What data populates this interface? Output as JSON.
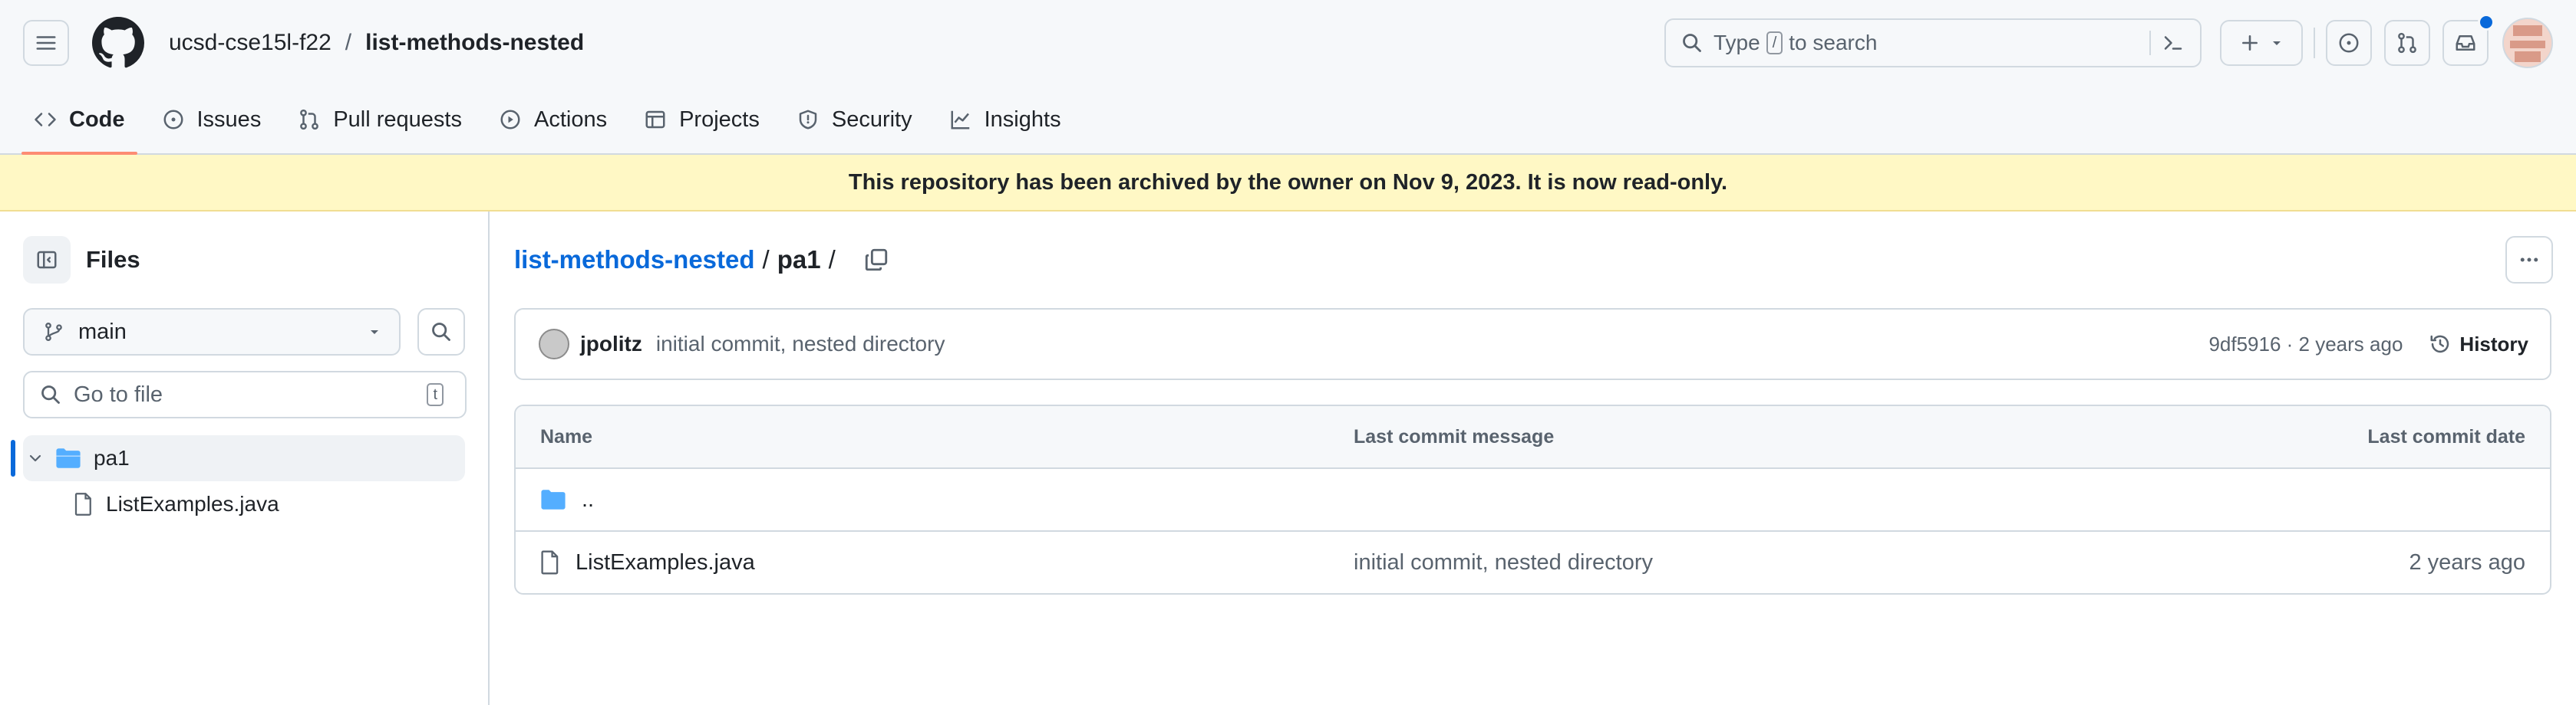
{
  "header": {
    "owner": "ucsd-cse15l-f22",
    "separator": "/",
    "repo": "list-methods-nested",
    "search": {
      "prefix": "Type",
      "key": "/",
      "suffix": "to search"
    }
  },
  "tabs": [
    {
      "label": "Code",
      "icon": "code-icon"
    },
    {
      "label": "Issues",
      "icon": "issue-icon"
    },
    {
      "label": "Pull requests",
      "icon": "pull-request-icon"
    },
    {
      "label": "Actions",
      "icon": "play-icon"
    },
    {
      "label": "Projects",
      "icon": "table-icon"
    },
    {
      "label": "Security",
      "icon": "shield-icon"
    },
    {
      "label": "Insights",
      "icon": "graph-icon"
    }
  ],
  "banner": {
    "text": "This repository has been archived by the owner on Nov 9, 2023. It is now read-only."
  },
  "sidebar": {
    "title": "Files",
    "branch": "main",
    "goto_placeholder": "Go to file",
    "goto_key": "t",
    "tree": [
      {
        "label": "pa1",
        "type": "folder",
        "expanded": true,
        "selected": true
      },
      {
        "label": "ListExamples.java",
        "type": "file"
      }
    ]
  },
  "breadcrumb": {
    "repo": "list-methods-nested",
    "sep": "/",
    "current": "pa1",
    "trail": "/"
  },
  "commit": {
    "author": "jpolitz",
    "message": "initial commit, nested directory",
    "meta": "9df5916 · 2 years ago",
    "history": "History"
  },
  "table": {
    "headers": {
      "name": "Name",
      "message": "Last commit message",
      "date": "Last commit date"
    },
    "parent": "..",
    "rows": [
      {
        "name": "ListExamples.java",
        "message": "initial commit, nested directory",
        "date": "2 years ago"
      }
    ]
  },
  "colors": {
    "accent": "#0969da",
    "tab_underline": "#fd8c73",
    "banner_bg": "#fff8c5",
    "folder": "#54aeff"
  }
}
